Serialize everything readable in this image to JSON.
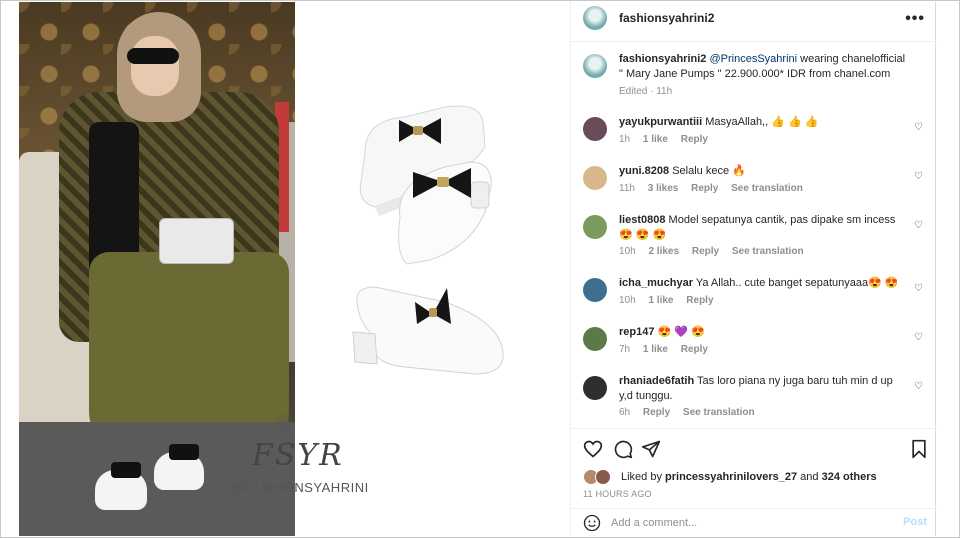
{
  "post": {
    "owner": "fashionsyahrini2",
    "watermark_handle": "@FASHIONSYAHRINI",
    "watermark_monogram": "FSYR",
    "caption": {
      "username": "fashionsyahrini2",
      "mention": "@PrincesSyahrini",
      "text": " wearing chanelofficial \" Mary Jane Pumps \" 22.900.000* IDR from chanel.com",
      "meta": "Edited · 11h"
    },
    "comments": [
      {
        "username": "yayukpurwantiii",
        "text": "MasyaAllah,, 👍 👍 👍",
        "time": "1h",
        "likes": "1 like",
        "reply": "Reply",
        "translate": "",
        "avatar_color": "#6b4a5a"
      },
      {
        "username": "yuni.8208",
        "text": "Selalu kece 🔥",
        "time": "11h",
        "likes": "3 likes",
        "reply": "Reply",
        "translate": "See translation",
        "avatar_color": "#d8b88a"
      },
      {
        "username": "liest0808",
        "text": "Model sepatunya cantik, pas dipake sm incess😍 😍 😍",
        "time": "10h",
        "likes": "2 likes",
        "reply": "Reply",
        "translate": "See translation",
        "avatar_color": "#7a9a5e"
      },
      {
        "username": "icha_muchyar",
        "text": "Ya Allah.. cute banget sepatunyaaa😍 😍",
        "time": "10h",
        "likes": "1 like",
        "reply": "Reply",
        "translate": "",
        "avatar_color": "#3f6f8f"
      },
      {
        "username": "rep147",
        "text": "😍 💜 😍",
        "time": "7h",
        "likes": "1 like",
        "reply": "Reply",
        "translate": "",
        "avatar_color": "#5a7a4a"
      },
      {
        "username": "rhaniade6fatih",
        "text": "Tas loro piana ny juga baru tuh min d up y,d tunggu.",
        "time": "6h",
        "likes": "",
        "reply": "Reply",
        "translate": "See translation",
        "avatar_color": "#2e2e2e"
      }
    ],
    "likes": {
      "prefix": "Liked by ",
      "user": "princessyahrinilovers_27",
      "and": " and ",
      "others": "324 others"
    },
    "time_ago": "11 HOURS AGO",
    "add_comment_placeholder": "Add a comment...",
    "post_label": "Post",
    "menu_label": "•••"
  },
  "colors": {
    "link": "#00376b",
    "muted": "#8e8e8e",
    "post_disabled": "#b2dffc"
  },
  "icons": [
    "heart-icon",
    "comment-icon",
    "share-icon",
    "bookmark-icon",
    "emoji-icon",
    "more-icon"
  ]
}
